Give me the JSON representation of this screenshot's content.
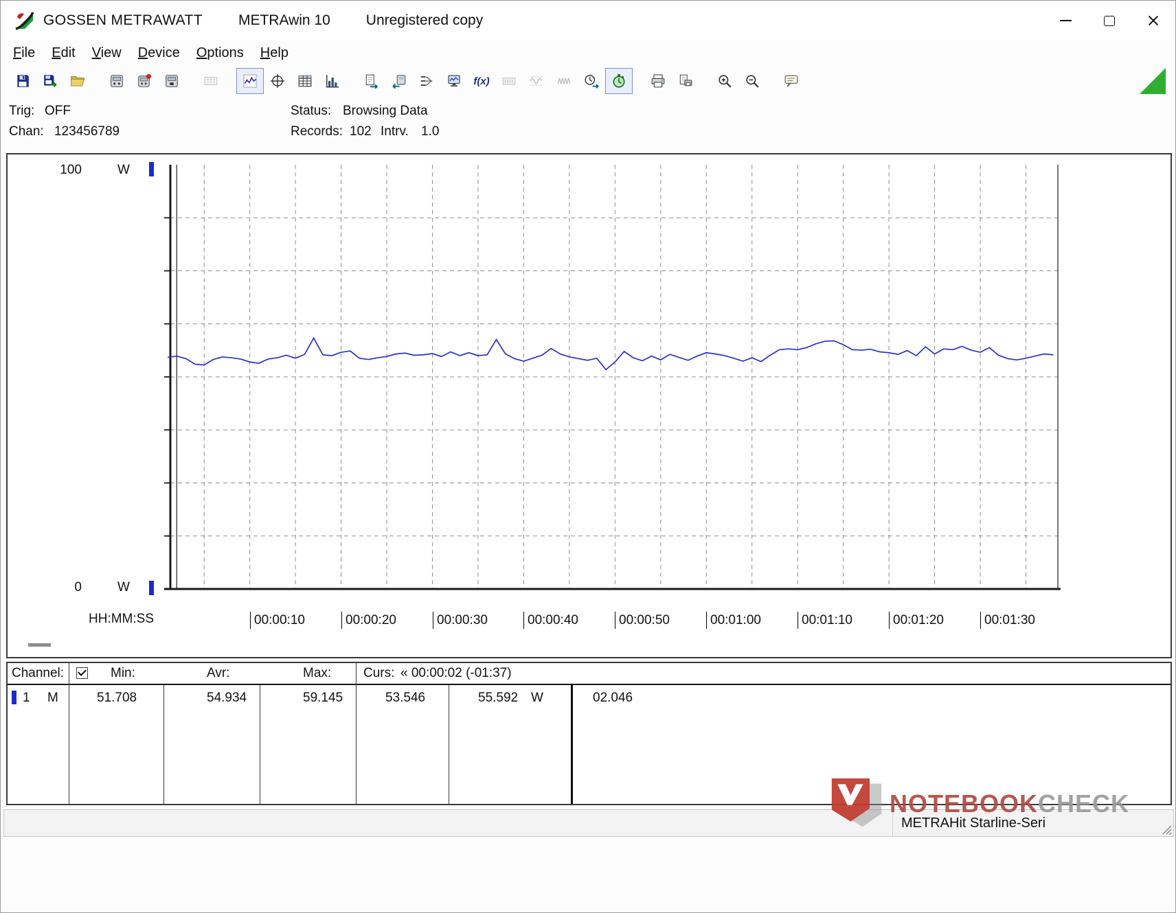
{
  "window": {
    "brand": "GOSSEN METRAWATT",
    "app": "METRAwin 10",
    "license": "Unregistered copy"
  },
  "menu": {
    "items": [
      "File",
      "Edit",
      "View",
      "Device",
      "Options",
      "Help"
    ]
  },
  "toolbar": {
    "fx_label": "f(x)",
    "icons": [
      "save",
      "save-as",
      "open",
      "device-settings",
      "device-clock",
      "device-memory",
      "numeric-display",
      "yt-chart",
      "xy-chart",
      "table-view",
      "histogram",
      "file-export",
      "device-download",
      "channel-setup",
      "monitor",
      "formula",
      "lcd-display",
      "analog-wave",
      "recorder-wave",
      "time-sync",
      "record-stopwatch",
      "print",
      "print-preview",
      "zoom-in",
      "zoom-out",
      "annotation"
    ],
    "selected": [
      "yt-chart",
      "record-stopwatch"
    ]
  },
  "status": {
    "trig_label": "Trig:",
    "trig_value": "OFF",
    "chan_label": "Chan:",
    "chan_value": "123456789",
    "status_label": "Status:",
    "status_value": "Browsing Data",
    "records_label": "Records:",
    "records_value": "102",
    "interval_label": "Intrv.",
    "interval_value": "1.0"
  },
  "chart": {
    "y_top": "100",
    "y_unit_top": "W",
    "y_bottom": "0",
    "y_unit_bottom": "W",
    "x_format_label": "HH:MM:SS",
    "x_ticks": [
      "00:00:10",
      "00:00:20",
      "00:00:30",
      "00:00:40",
      "00:00:50",
      "00:01:00",
      "00:01:10",
      "00:01:20",
      "00:01:30"
    ]
  },
  "chart_data": {
    "type": "line",
    "title": "",
    "ylabel": "W",
    "ylim": [
      0,
      100
    ],
    "y_grid_divisions": 8,
    "x_grid_step_s": 5,
    "x_range_s": [
      1.3,
      98.5
    ],
    "x_start_s": 1,
    "interval_s": 1,
    "records": 102,
    "grid": "dashed",
    "cursors_s": [
      2,
      98.5
    ],
    "cursor_readout": {
      "label": "Curs: « 00:00:02 (-01:37)",
      "value1_w": 53.546,
      "value2_w": 55.592,
      "delta_w": 2.046
    },
    "stats": {
      "min_w": 51.708,
      "avr_w": 54.934,
      "max_w": 59.145
    },
    "series": [
      {
        "name": "Channel 1 (M)",
        "color": "#2531c9",
        "values": [
          54.6,
          54.9,
          54.3,
          53.0,
          52.8,
          54.1,
          54.7,
          54.5,
          54.2,
          53.5,
          53.2,
          54.2,
          54.5,
          55.1,
          54.4,
          55.3,
          59.145,
          55.2,
          55.0,
          55.8,
          56.1,
          54.4,
          54.1,
          54.5,
          54.8,
          55.4,
          55.6,
          55.1,
          55.2,
          55.5,
          54.8,
          55.9,
          55.0,
          55.7,
          55.0,
          55.2,
          58.8,
          55.4,
          54.3,
          53.7,
          54.4,
          55.1,
          56.7,
          55.4,
          54.7,
          54.3,
          53.9,
          54.4,
          51.708,
          53.5,
          56.0,
          54.5,
          53.8,
          54.9,
          54.0,
          55.3,
          54.6,
          53.9,
          54.9,
          55.7,
          55.4,
          55.0,
          54.4,
          53.7,
          54.5,
          53.6,
          55.1,
          56.4,
          56.6,
          56.4,
          56.9,
          57.8,
          58.4,
          58.5,
          57.6,
          56.4,
          56.3,
          56.5,
          55.9,
          55.7,
          55.3,
          56.2,
          55.0,
          57.1,
          55.4,
          56.6,
          56.4,
          57.2,
          56.3,
          55.8,
          56.9,
          55.1,
          54.3,
          54.0,
          54.4,
          54.9,
          55.4,
          55.2
        ]
      }
    ]
  },
  "table": {
    "headers": {
      "channel": "Channel:",
      "min": "Min:",
      "avr": "Avr:",
      "max": "Max:",
      "curs_label": "Curs:",
      "curs_value": "« 00:00:02 (-01:37)"
    },
    "row": {
      "channel": "1",
      "mode": "M",
      "min": "51.708",
      "avr": "54.934",
      "max": "59.145",
      "curs1": "53.546",
      "curs2": "55.592",
      "curs2_unit": "W",
      "delta": "02.046"
    }
  },
  "statusbar": {
    "device": "METRAHit Starline-Seri"
  },
  "watermark": {
    "text1": "NOTEBOOK",
    "text2": "CHECK"
  },
  "colors": {
    "trace": "#2531c9",
    "channel_marker": "#1b2bd0",
    "toolbar_triangle": "#2fae2f"
  }
}
